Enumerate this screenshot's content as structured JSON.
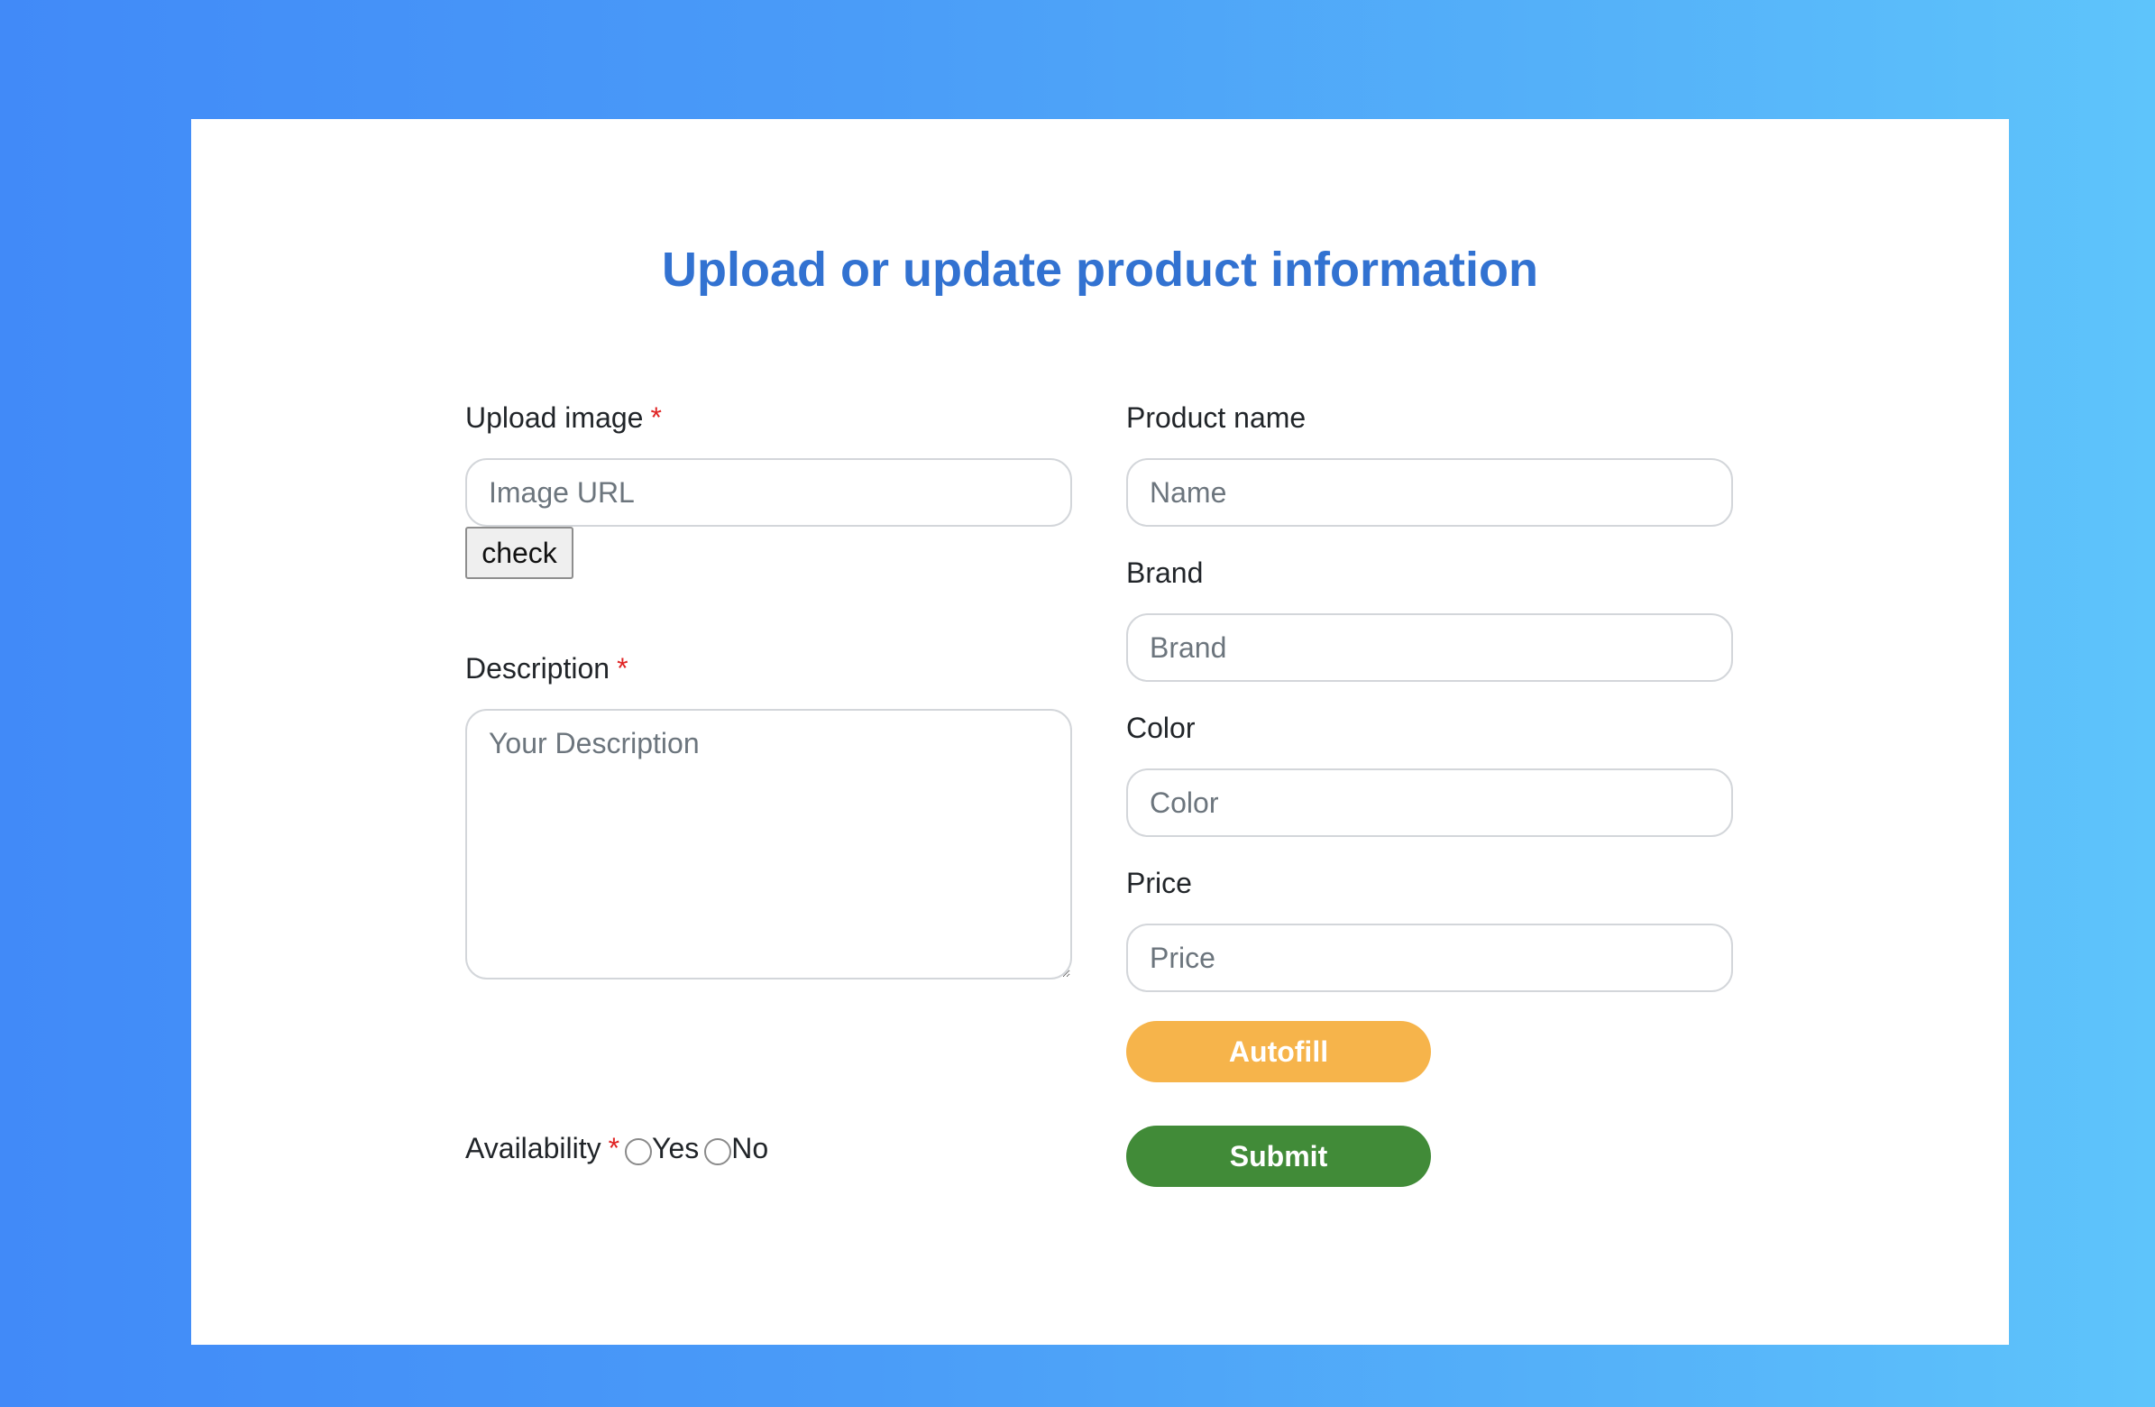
{
  "page": {
    "title": "Upload or update product information"
  },
  "left": {
    "image": {
      "label": "Upload image",
      "required_mark": "*",
      "placeholder": "Image URL",
      "check_label": "check"
    },
    "description": {
      "label": "Description",
      "required_mark": "*",
      "placeholder": "Your Description"
    },
    "availability": {
      "label": "Availability",
      "required_mark": "*",
      "options": [
        "Yes",
        "No"
      ]
    }
  },
  "right": {
    "product_name": {
      "label": "Product name",
      "placeholder": "Name"
    },
    "brand": {
      "label": "Brand",
      "placeholder": "Brand"
    },
    "color": {
      "label": "Color",
      "placeholder": "Color"
    },
    "price": {
      "label": "Price",
      "placeholder": "Price"
    },
    "autofill_label": "Autofill",
    "submit_label": "Submit"
  },
  "colors": {
    "background_start": "#418af8",
    "background_end": "#5ec4fb",
    "title": "#3272d1",
    "required": "#e02424",
    "autofill": "#f6b44b",
    "submit": "#418b38"
  }
}
